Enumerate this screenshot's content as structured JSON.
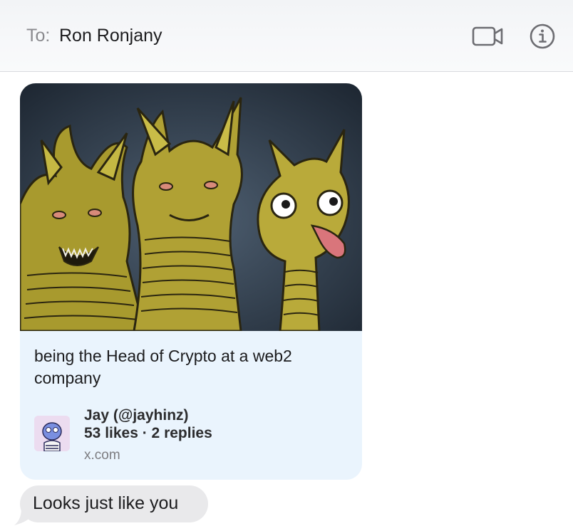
{
  "header": {
    "to_label": "To:",
    "recipient": "Ron Ronjany",
    "video_icon": "video-camera-icon",
    "info_icon": "info-icon"
  },
  "link_preview": {
    "image": "three-headed-dragon-meme",
    "title": "being the Head of Crypto at a web2 company",
    "author": "Jay (@jayhinz)",
    "stats": "53 likes · 2 replies",
    "domain": "x.com"
  },
  "message": {
    "text": "Looks just like you"
  },
  "colors": {
    "card_background": "#eaf4fd",
    "bubble_background": "#e9e9eb",
    "icon_gray": "#6d6d72"
  }
}
